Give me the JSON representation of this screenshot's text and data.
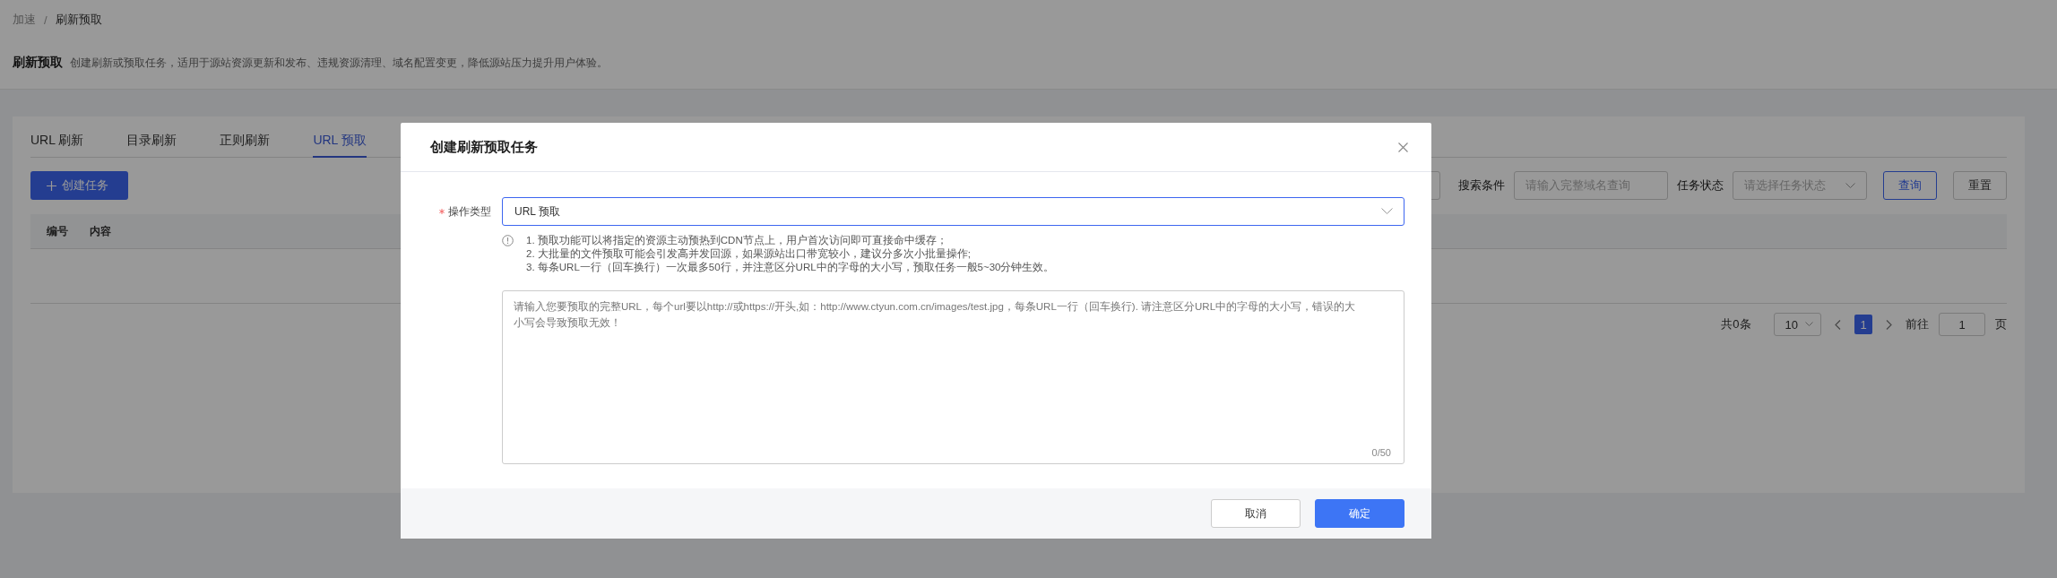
{
  "breadcrumb": {
    "items": [
      "加速",
      "刷新预取"
    ],
    "separator": "/"
  },
  "page": {
    "title": "刷新预取",
    "description": "创建刷新或预取任务，适用于源站资源更新和发布、违规资源清理、域名配置变更，降低源站压力提升用户体验。"
  },
  "tabs": [
    {
      "label": "URL 刷新",
      "selected": false
    },
    {
      "label": "目录刷新",
      "selected": false
    },
    {
      "label": "正则刷新",
      "selected": false
    },
    {
      "label": "URL 预取",
      "selected": true
    }
  ],
  "create_button": {
    "label": "创建任务"
  },
  "filters": [
    {
      "kind": "input",
      "label": "搜索条件",
      "placeholder": "请输入完整域名查询"
    },
    {
      "kind": "select",
      "label": "任务状态",
      "placeholder": "请选择任务状态"
    }
  ],
  "filter_buttons": [
    {
      "label": "查询",
      "kind": "primary"
    },
    {
      "label": "重置",
      "kind": "default"
    }
  ],
  "table": {
    "columns": [
      "编号",
      "内容"
    ]
  },
  "pagination": {
    "total": "共0条",
    "page_size": "10",
    "pages": [
      {
        "label": "1",
        "selected": true
      }
    ],
    "goto_label": "前往",
    "goto_value": "1",
    "goto_suffix": "页"
  },
  "dialog": {
    "title": "创建刷新预取任务",
    "field": {
      "label": "操作类型",
      "required": true,
      "value": "URL 预取"
    },
    "notes": [
      "1. 预取功能可以将指定的资源主动预热到CDN节点上，用户首次访问即可直接命中缓存；",
      "2. 大批量的文件预取可能会引发高并发回源，如果源站出口带宽较小，建议分多次小批量操作;",
      "3. 每条URL一行（回车换行）一次最多50行，并注意区分URL中的字母的大小写，预取任务一般5~30分钟生效。"
    ],
    "textarea": {
      "placeholder": "请输入您要预取的完整URL，每个url要以http://或https://开头,如：http://www.ctyun.com.cn/images/test.jpg，每条URL一行（回车换行). 请注意区分URL中的字母的大小写，错误的大小写会导致预取无效！",
      "counter": "0/50"
    },
    "buttons": [
      {
        "label": "取消",
        "kind": "default"
      },
      {
        "label": "确定",
        "kind": "primary"
      }
    ]
  }
}
